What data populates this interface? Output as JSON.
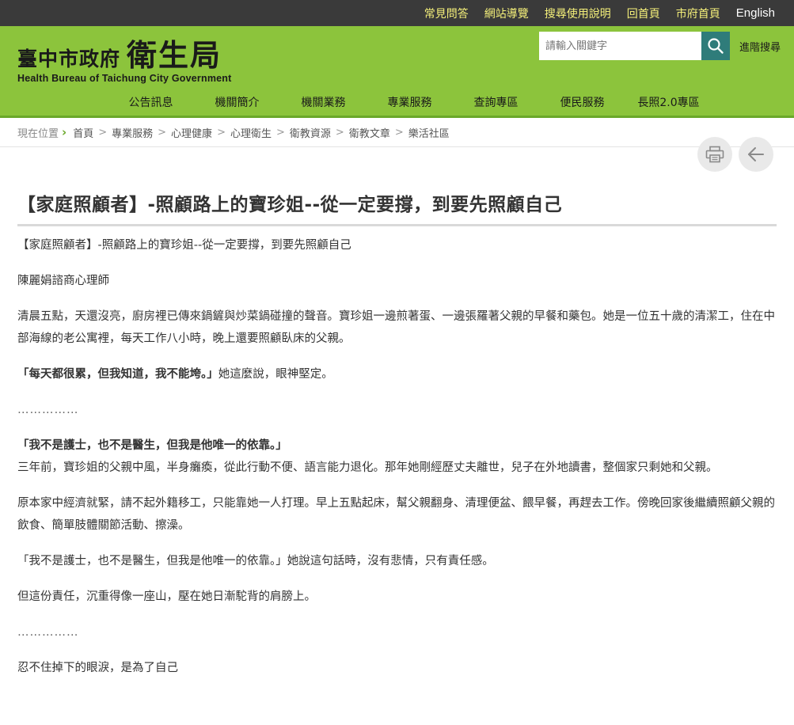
{
  "topbar": {
    "links": [
      "常見問答",
      "網站導覽",
      "搜尋使用說明",
      "回首頁",
      "市府首頁",
      "English"
    ]
  },
  "logo": {
    "city": "臺中市政府",
    "bureau": "衛生局",
    "english": "Health Bureau of Taichung City Government"
  },
  "search": {
    "placeholder": "請輸入關鍵字",
    "advanced": "進階搜尋"
  },
  "nav": {
    "items": [
      "公告訊息",
      "機關簡介",
      "機關業務",
      "專業服務",
      "查詢專區",
      "便民服務",
      "長照2.0專區"
    ]
  },
  "breadcrumb": {
    "label": "現在位置",
    "items": [
      "首頁",
      "專業服務",
      "心理健康",
      "心理衛生",
      "衛教資源",
      "衛教文章",
      "樂活社區"
    ]
  },
  "tools": {
    "print_icon": "printer-icon",
    "back_icon": "arrow-left-icon"
  },
  "article": {
    "title": "【家庭照顧者】-照顧路上的寶珍姐--從一定要撐，到要先照顧自己",
    "paragraphs": [
      "【家庭照顧者】-照顧路上的寶珍姐--從一定要撐，到要先照顧自己",
      "陳麗娟諮商心理師",
      "清晨五點，天還沒亮，廚房裡已傳來鍋鏟與炒菜鍋碰撞的聲音。寶珍姐一邊煎著蛋、一邊張羅著父親的早餐和藥包。她是一位五十歲的清潔工，住在中部海線的老公寓裡，每天工作八小時，晚上還要照顧臥床的父親。",
      "「每天都很累，但我知道，我不能垮。」",
      "她這麼說，眼神堅定。",
      "……………",
      "「我不是護士，也不是醫生，但我是他唯一的依靠。」",
      "三年前，寶珍姐的父親中風，半身癱瘓，從此行動不便、語言能力退化。那年她剛經歷丈夫離世，兒子在外地讀書，整個家只剩她和父親。",
      "原本家中經濟就緊，請不起外籍移工，只能靠她一人打理。早上五點起床，幫父親翻身、清理便盆、餵早餐，再趕去工作。傍晚回家後繼續照顧父親的飲食、簡單肢體關節活動、擦澡。",
      "「我不是護士，也不是醫生，但我是他唯一的依靠。」她說這句話時，沒有悲情，只有責任感。",
      "但這份責任，沉重得像一座山，壓在她日漸駝背的肩膀上。",
      "……………",
      "忍不住掉下的眼淚，是為了自己"
    ]
  },
  "colors": {
    "topbar_bg": "#3a3a3a",
    "topbar_link": "#f5f07a",
    "header_green": "#8cc43c",
    "search_button": "#2f7c7a"
  }
}
